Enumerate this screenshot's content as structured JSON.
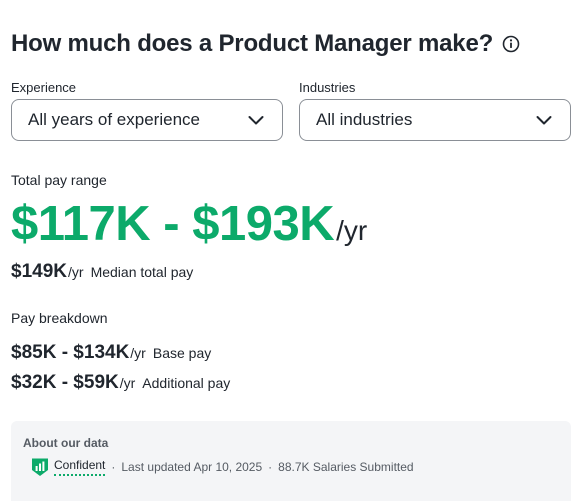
{
  "heading": {
    "title": "How much does a Product Manager make?",
    "info_icon": "info-circle-icon"
  },
  "filters": {
    "experience": {
      "label": "Experience",
      "value": "All years of experience",
      "icon": "chevron-down-icon"
    },
    "industries": {
      "label": "Industries",
      "value": "All industries",
      "icon": "chevron-down-icon"
    }
  },
  "total_pay": {
    "label": "Total pay range",
    "range": "$117K - $193K",
    "unit": "/yr",
    "median_amount": "$149K",
    "median_unit": "/yr",
    "median_label": "Median total pay"
  },
  "breakdown": {
    "label": "Pay breakdown",
    "items": [
      {
        "amount": "$85K - $134K",
        "unit": "/yr",
        "label": "Base pay"
      },
      {
        "amount": "$32K - $59K",
        "unit": "/yr",
        "label": "Additional pay"
      }
    ]
  },
  "about": {
    "title": "About our data",
    "confidence_icon": "confidence-shield-icon",
    "confidence": "Confident",
    "separator": "·",
    "updated": "Last updated Apr 10, 2025",
    "salaries": "88.7K Salaries Submitted"
  },
  "colors": {
    "accent_green": "#0caa6a",
    "text": "#20262e",
    "muted": "#555b63",
    "panel_bg": "#f4f5f7"
  }
}
